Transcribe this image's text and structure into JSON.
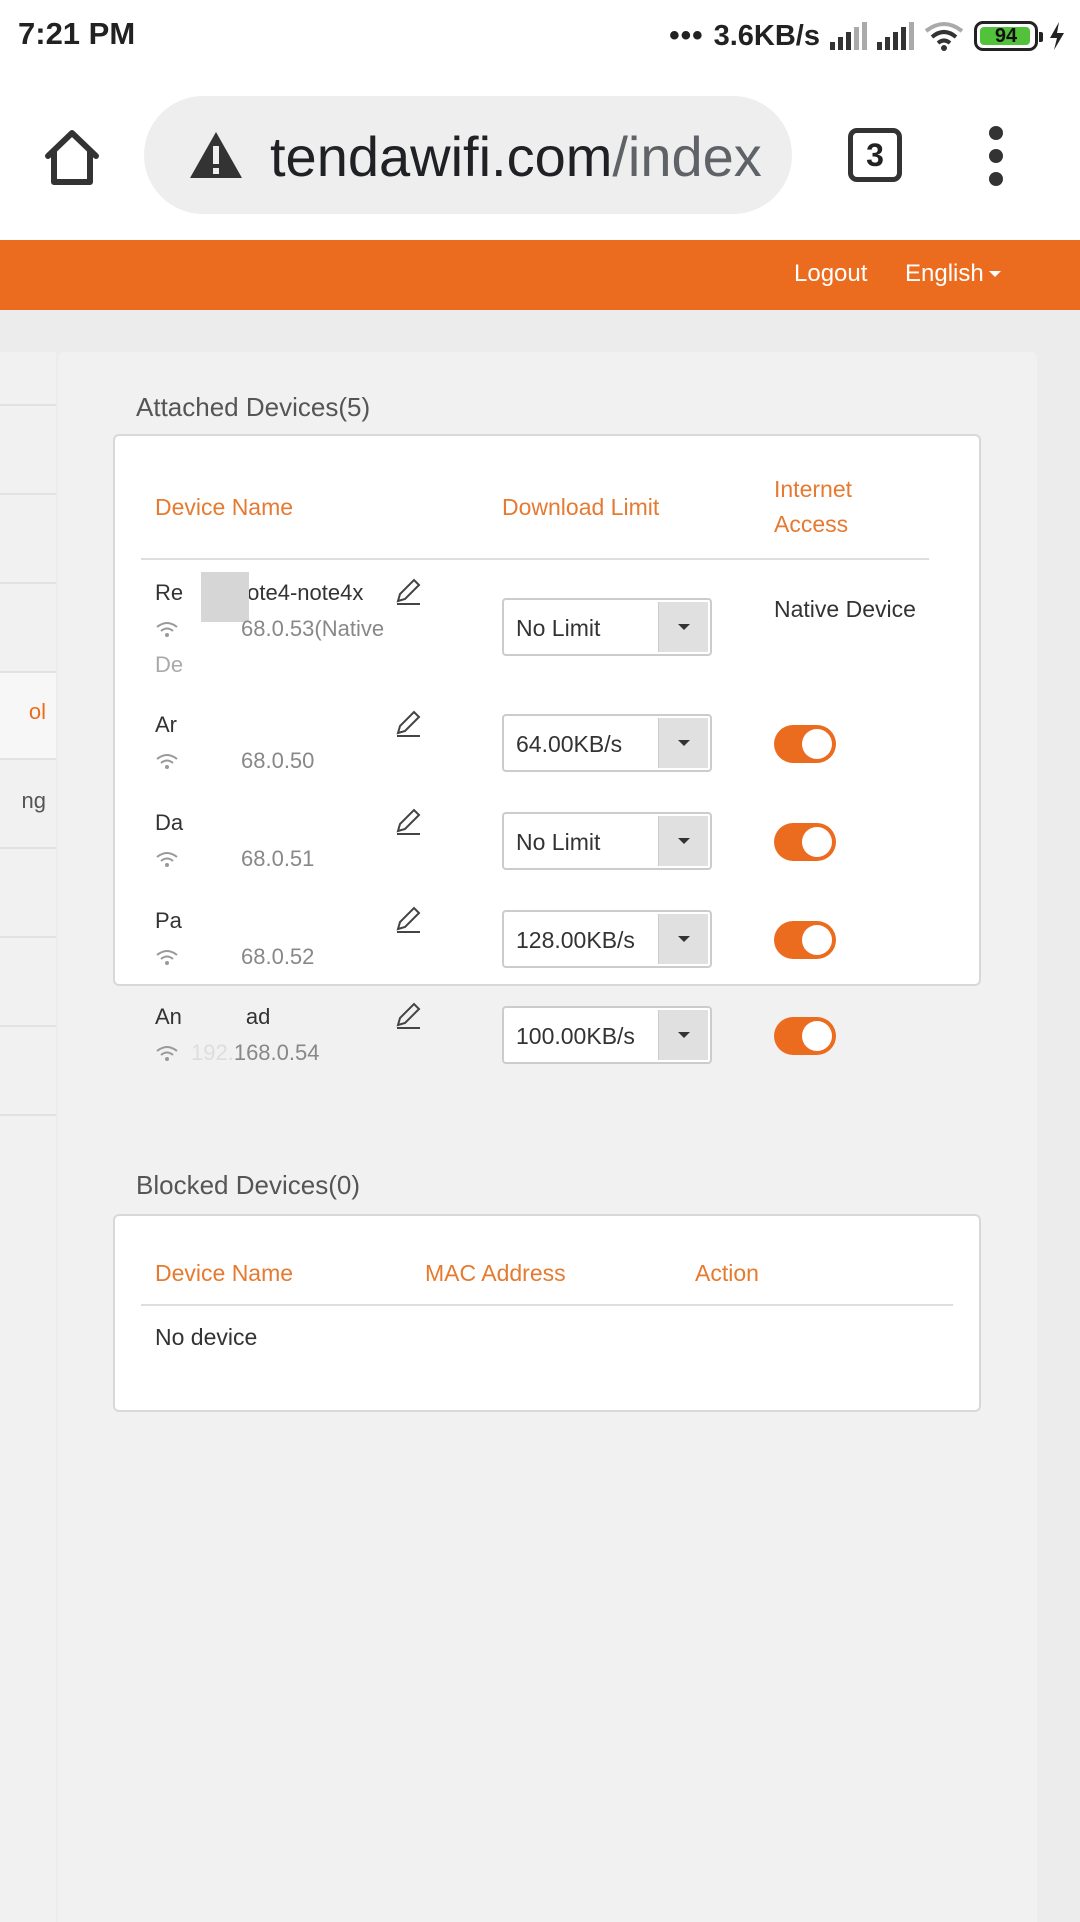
{
  "status_bar": {
    "time": "7:21 PM",
    "dots": "•••",
    "network_speed": "3.6KB/s",
    "battery_level": "94",
    "colors": {
      "battery": "#53c23b"
    }
  },
  "browser": {
    "url_host": "tendawifi.com",
    "url_path": "/index",
    "tab_count": "3"
  },
  "header": {
    "logout_label": "Logout",
    "language_label": "English",
    "accent_color": "#ec6c1f"
  },
  "sidebar": {
    "items": [
      {
        "label": ""
      },
      {
        "label": ""
      },
      {
        "label": ""
      },
      {
        "label": "ol",
        "active": true
      },
      {
        "label": "ng"
      },
      {
        "label": ""
      },
      {
        "label": ""
      },
      {
        "label": ""
      }
    ]
  },
  "attached": {
    "title": "Attached Devices(5)",
    "headers": {
      "device_name": "Device Name",
      "download_limit": "Download Limit",
      "internet_access": "Internet Access"
    },
    "devices": [
      {
        "name_a": "Re",
        "name_b": "ote4-note4x",
        "ip": "68.0.53(Native",
        "extra": "De",
        "limit": "No Limit",
        "access": "Native Device"
      },
      {
        "name_a": "Ar",
        "name_b": "",
        "ip": "68.0.50",
        "limit": "64.00KB/s",
        "access_on": true
      },
      {
        "name_a": "Da",
        "name_b": "",
        "ip": "68.0.51",
        "limit": "No Limit",
        "access_on": true
      },
      {
        "name_a": "Pa",
        "name_b": "",
        "ip": "68.0.52",
        "limit": "128.00KB/s",
        "access_on": true
      },
      {
        "name_a": "An",
        "name_b": "ad",
        "ip_a": "192.",
        "ip": "168.0.54",
        "limit": "100.00KB/s",
        "access_on": true
      }
    ]
  },
  "blocked": {
    "title": "Blocked Devices(0)",
    "headers": {
      "device_name": "Device Name",
      "mac_address": "MAC Address",
      "action": "Action"
    },
    "empty_text": "No device"
  }
}
